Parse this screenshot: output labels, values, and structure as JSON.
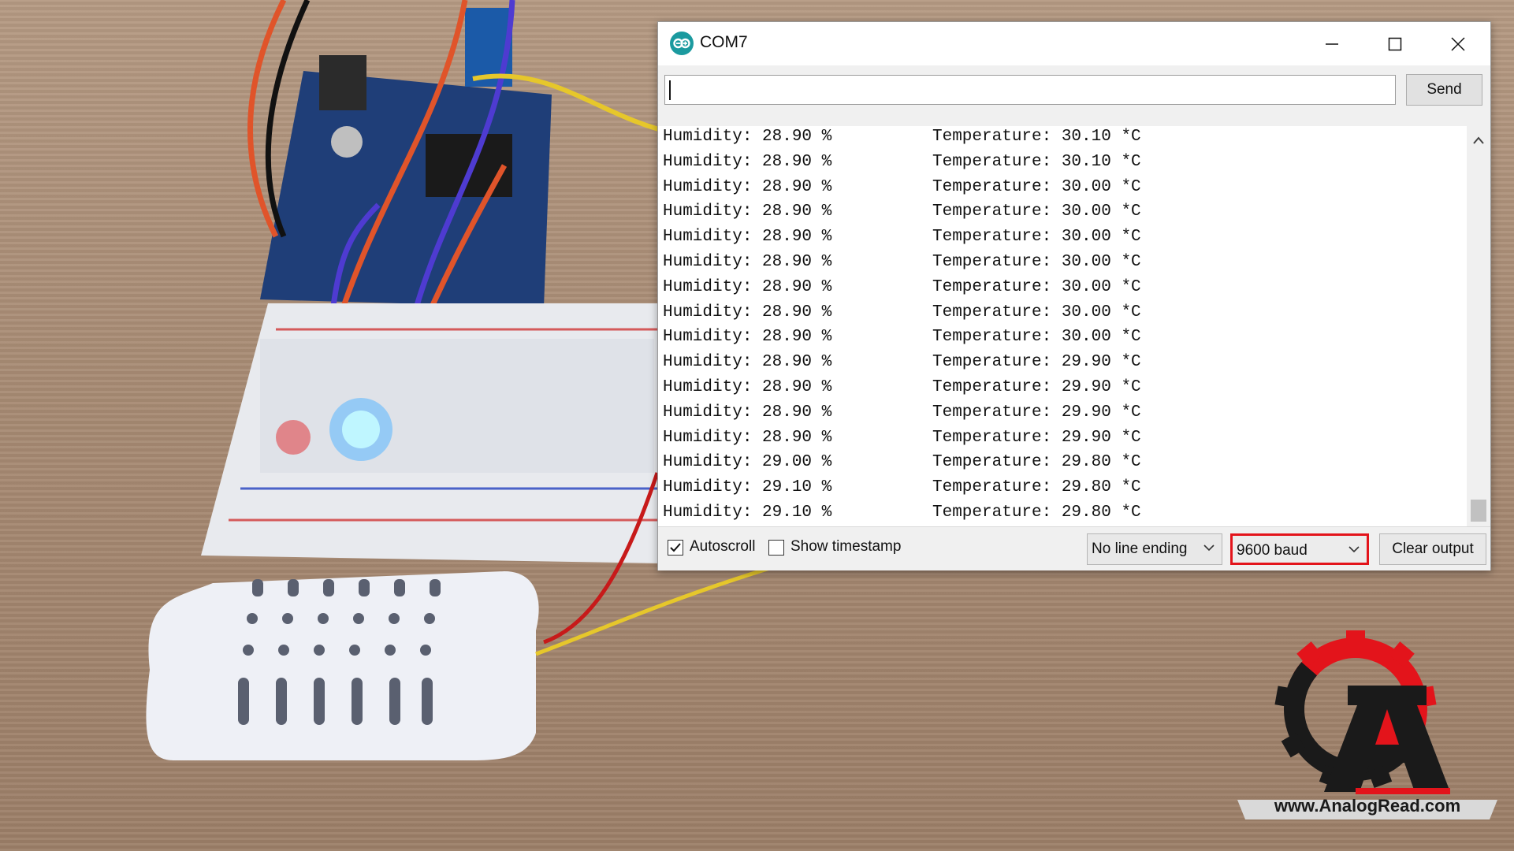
{
  "window": {
    "title": "COM7",
    "send_label": "Send",
    "input_value": ""
  },
  "serial_output": [
    {
      "humidity": "Humidity: 28.90 %",
      "temperature": "Temperature: 30.10 *C"
    },
    {
      "humidity": "Humidity: 28.90 %",
      "temperature": "Temperature: 30.10 *C"
    },
    {
      "humidity": "Humidity: 28.90 %",
      "temperature": "Temperature: 30.00 *C"
    },
    {
      "humidity": "Humidity: 28.90 %",
      "temperature": "Temperature: 30.00 *C"
    },
    {
      "humidity": "Humidity: 28.90 %",
      "temperature": "Temperature: 30.00 *C"
    },
    {
      "humidity": "Humidity: 28.90 %",
      "temperature": "Temperature: 30.00 *C"
    },
    {
      "humidity": "Humidity: 28.90 %",
      "temperature": "Temperature: 30.00 *C"
    },
    {
      "humidity": "Humidity: 28.90 %",
      "temperature": "Temperature: 30.00 *C"
    },
    {
      "humidity": "Humidity: 28.90 %",
      "temperature": "Temperature: 30.00 *C"
    },
    {
      "humidity": "Humidity: 28.90 %",
      "temperature": "Temperature: 29.90 *C"
    },
    {
      "humidity": "Humidity: 28.90 %",
      "temperature": "Temperature: 29.90 *C"
    },
    {
      "humidity": "Humidity: 28.90 %",
      "temperature": "Temperature: 29.90 *C"
    },
    {
      "humidity": "Humidity: 28.90 %",
      "temperature": "Temperature: 29.90 *C"
    },
    {
      "humidity": "Humidity: 29.00 %",
      "temperature": "Temperature: 29.80 *C"
    },
    {
      "humidity": "Humidity: 29.10 %",
      "temperature": "Temperature: 29.80 *C"
    },
    {
      "humidity": "Humidity: 29.10 %",
      "temperature": "Temperature: 29.80 *C"
    }
  ],
  "bottom": {
    "autoscroll_label": "Autoscroll",
    "autoscroll_checked": true,
    "timestamp_label": "Show timestamp",
    "timestamp_checked": false,
    "line_ending_value": "No line ending",
    "baud_value": "9600 baud",
    "clear_label": "Clear output"
  },
  "colors": {
    "accent_highlight": "#e3141b",
    "app_icon": "#1b9a9f"
  },
  "icons": {
    "app": "arduino-icon",
    "minimize": "minimize-icon",
    "maximize": "maximize-icon",
    "close": "close-icon"
  },
  "watermark": {
    "text": "www.AnalogRead.com"
  }
}
